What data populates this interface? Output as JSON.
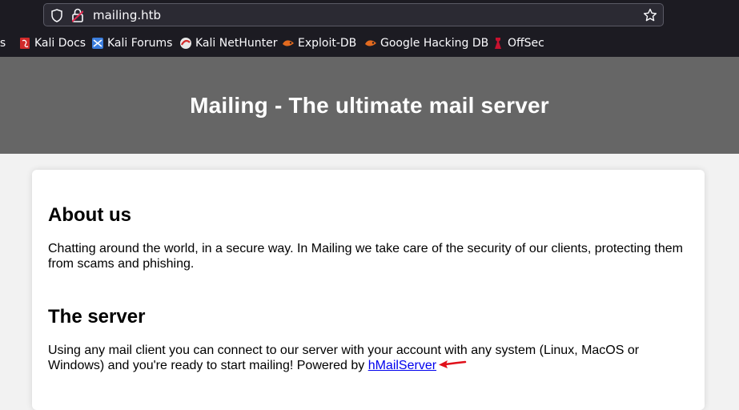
{
  "browser": {
    "url": "mailing.htb",
    "bookmarks": [
      {
        "label": "ls",
        "icon": "truncated-bookmark"
      },
      {
        "label": "Kali Docs",
        "icon": "kali-docs-icon"
      },
      {
        "label": "Kali Forums",
        "icon": "kali-forums-icon"
      },
      {
        "label": "Kali NetHunter",
        "icon": "kali-nethunter-icon"
      },
      {
        "label": "Exploit-DB",
        "icon": "exploit-db-icon"
      },
      {
        "label": "Google Hacking DB",
        "icon": "google-hacking-db-icon"
      },
      {
        "label": "OffSec",
        "icon": "offsec-icon"
      }
    ]
  },
  "page": {
    "banner_title": "Mailing - The ultimate mail server",
    "about": {
      "heading": "About us",
      "text": "Chatting around the world, in a secure way. In Mailing we take care of the security of our clients, protecting them from scams and phishing."
    },
    "server": {
      "heading": "The server",
      "text": "Using any mail client you can connect to our server with your account with any system (Linux, MacOS or Windows) and you're ready to start mailing! Powered by ",
      "link_text": "hMailServer"
    }
  },
  "colors": {
    "banner": "#666666",
    "link": "#0000ee",
    "annotation_arrow": "#e0101a"
  }
}
